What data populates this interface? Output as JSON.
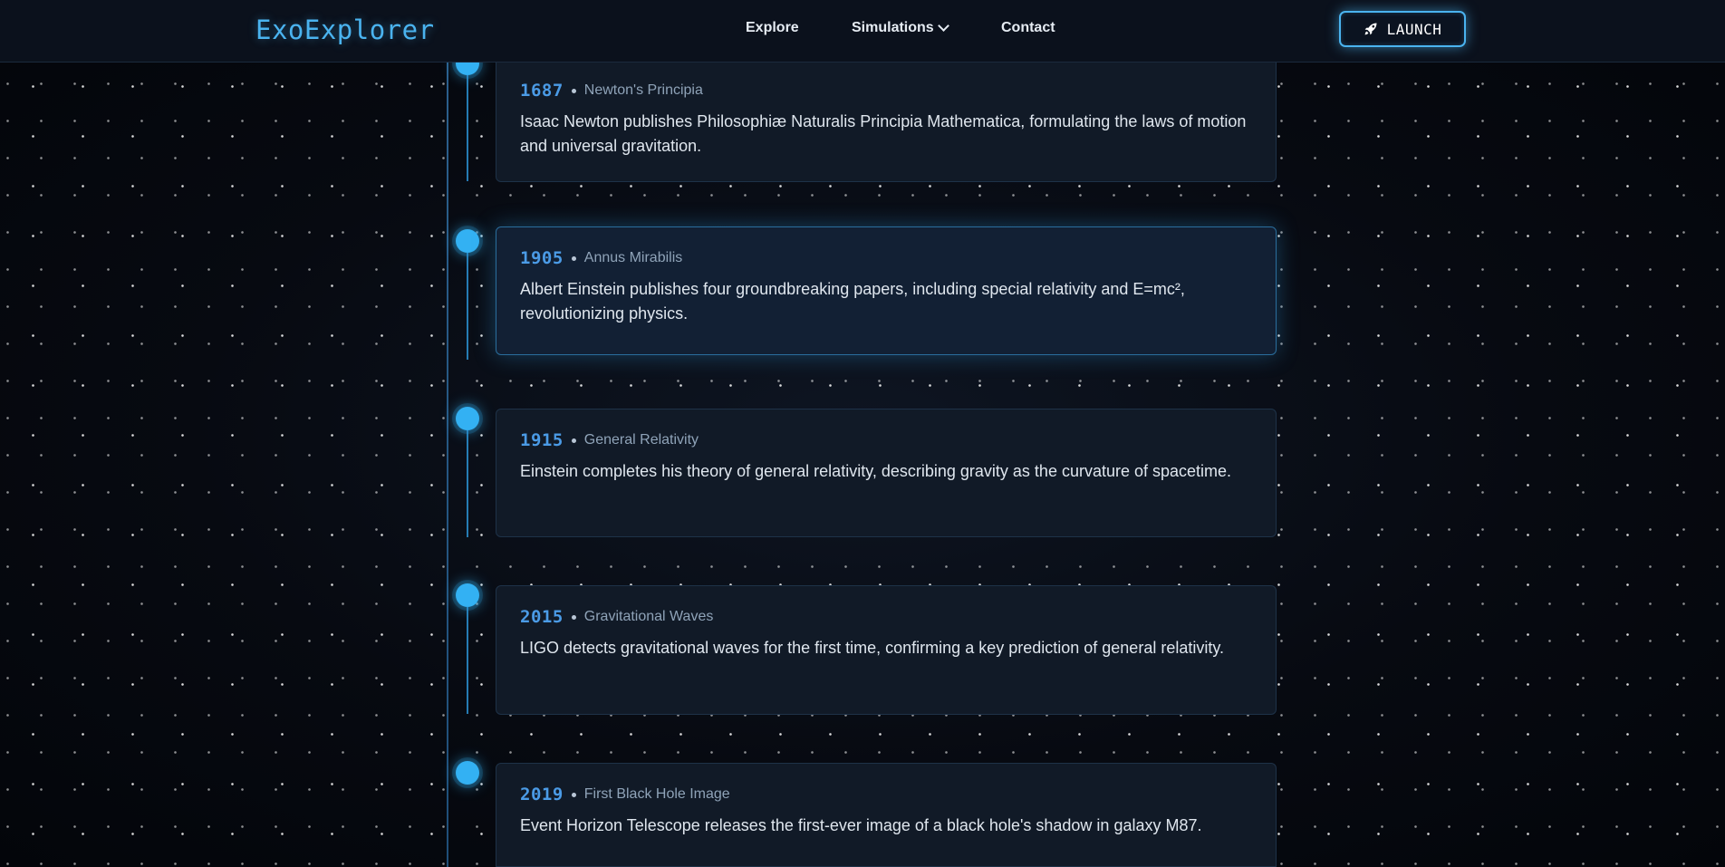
{
  "nav": {
    "logo": "ExoExplorer",
    "links": [
      "Explore",
      "Simulations",
      "Contact"
    ],
    "launch_label": "LAUNCH"
  },
  "timeline": [
    {
      "year": "1687",
      "title": "Newton's Principia",
      "description": "Isaac Newton publishes Philosophiæ Naturalis Principia Mathematica, formulating the laws of motion and universal gravitation."
    },
    {
      "year": "1905",
      "title": "Annus Mirabilis",
      "description": "Albert Einstein publishes four groundbreaking papers, including special relativity and E=mc², revolutionizing physics."
    },
    {
      "year": "1915",
      "title": "General Relativity",
      "description": "Einstein completes his theory of general relativity, describing gravity as the curvature of spacetime."
    },
    {
      "year": "2015",
      "title": "Gravitational Waves",
      "description": "LIGO detects gravitational waves for the first time, confirming a key prediction of general relativity."
    },
    {
      "year": "2019",
      "title": "First Black Hole Image",
      "description": "Event Horizon Telescope releases the first-ever image of a black hole's shadow in galaxy M87."
    }
  ],
  "icons": {
    "launch": "rocket-icon",
    "simulations_dropdown": "chevron-down-icon"
  },
  "colors": {
    "accent": "#4ab3ef",
    "node": "#33b1f3",
    "year": "#4b9be6",
    "background": "#05070c"
  }
}
